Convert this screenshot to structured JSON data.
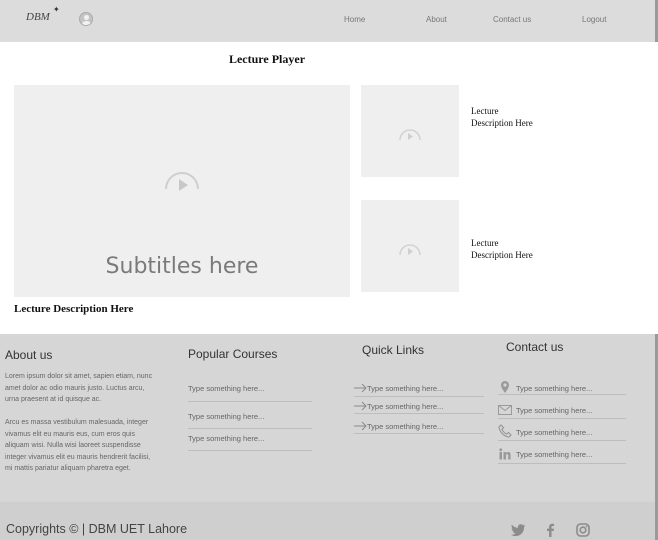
{
  "header": {
    "logo_text": "DBM",
    "nav": [
      {
        "label": "Home"
      },
      {
        "label": "About"
      },
      {
        "label": "Contact us"
      },
      {
        "label": "Logout"
      }
    ]
  },
  "main": {
    "title": "Lecture Player",
    "player": {
      "subtitles": "Subtitles here",
      "icon": "play-icon"
    },
    "description": "Lecture Description Here",
    "side_lectures": [
      {
        "description": "Lecture Description Here"
      },
      {
        "description": "Lecture Description Here"
      }
    ]
  },
  "footer": {
    "about": {
      "heading": "About us",
      "para1": "Lorem ipsum dolor sit amet, sapien etiam, nunc amet dolor ac odio mauris justo. Luctus arcu, urna praesent at id quisque ac.",
      "para2": "Arcu es massa vestibulum malesuada, integer vivamus elit eu mauris eus, cum eros quis aliquam wisi. Nulla wisi laoreet suspendisse integer vivamus elit eu mauris hendrerit facilisi, mi mattis pariatur aliquam pharetra eget."
    },
    "popular": {
      "heading": "Popular Courses",
      "items": [
        "Type something here...",
        "Type something here...",
        "Type something here..."
      ]
    },
    "quick_links": {
      "heading": "Quick Links",
      "items": [
        "Type something here...",
        "Type something here...",
        "Type something here..."
      ]
    },
    "contact": {
      "heading": "Contact us",
      "items": [
        {
          "icon": "location-pin-icon",
          "text": "Type something here..."
        },
        {
          "icon": "mail-icon",
          "text": "Type something here..."
        },
        {
          "icon": "phone-icon",
          "text": "Type something here..."
        },
        {
          "icon": "linkedin-icon",
          "text": "Type something here..."
        }
      ]
    },
    "copyright": "Copyrights © | DBM UET Lahore",
    "social": [
      "twitter-icon",
      "facebook-icon",
      "instagram-icon"
    ]
  },
  "colors": {
    "header_bg": "#dcdcdc",
    "footer_bg": "#d6d6d6",
    "placeholder_bg": "#efefef"
  }
}
